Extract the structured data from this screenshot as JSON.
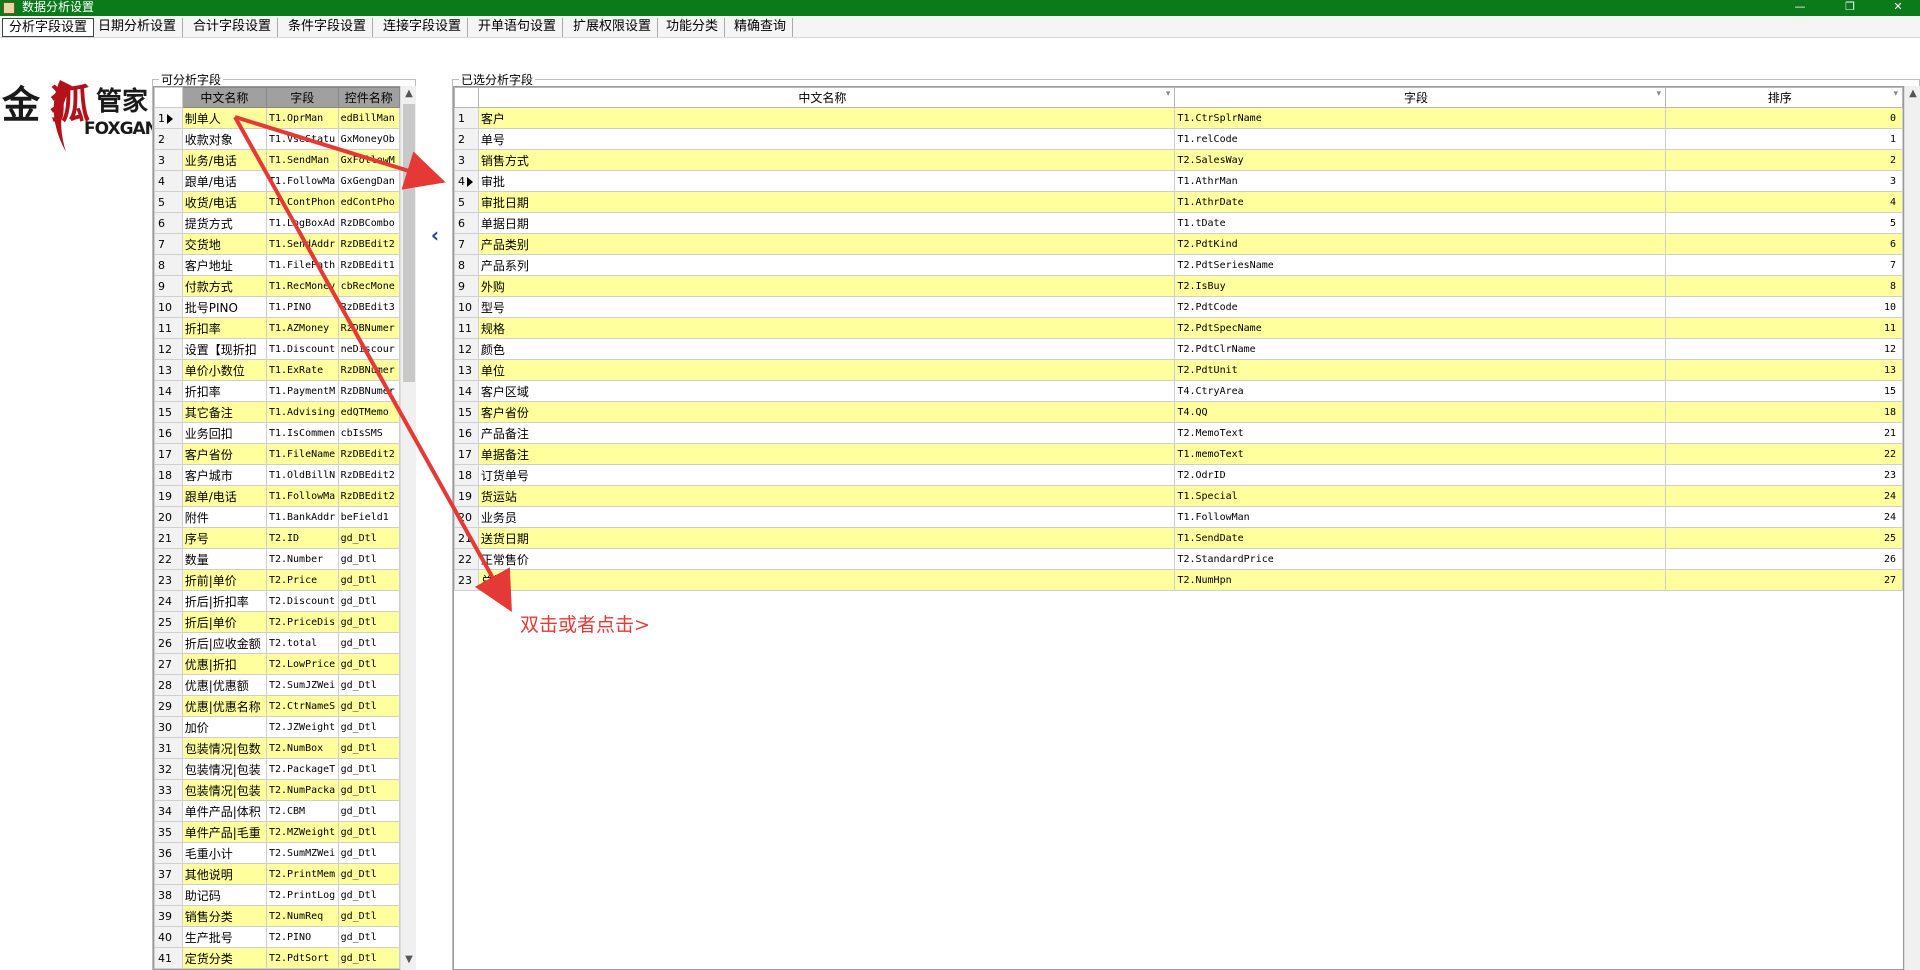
{
  "window": {
    "title": "数据分析设置"
  },
  "tabs": [
    {
      "label": "分析字段设置",
      "active": true
    },
    {
      "label": "日期分析设置",
      "active": false
    },
    {
      "label": "合计字段设置",
      "active": false
    },
    {
      "label": "条件字段设置",
      "active": false
    },
    {
      "label": "连接字段设置",
      "active": false
    },
    {
      "label": "开单语句设置",
      "active": false
    },
    {
      "label": "扩展权限设置",
      "active": false
    },
    {
      "label": "功能分类",
      "active": false
    },
    {
      "label": "精确查询",
      "active": false
    }
  ],
  "logo": {
    "cn": "金狐管家",
    "en": "FOXGAN"
  },
  "left_panel": {
    "label": "可分析字段",
    "columns": [
      "中文名称",
      "字段",
      "控件名称"
    ],
    "rows": [
      {
        "n": "1",
        "name": "制单人",
        "field": "T1.OprMan",
        "ctrl": "edBillMan",
        "y": true
      },
      {
        "n": "2",
        "name": "收款对象",
        "field": "T1.VseStatu",
        "ctrl": "GxMoneyOb",
        "y": false
      },
      {
        "n": "3",
        "name": "业务/电话",
        "field": "T1.SendMan",
        "ctrl": "GxFollowM",
        "y": true
      },
      {
        "n": "4",
        "name": "跟单/电话",
        "field": "T1.FollowMa",
        "ctrl": "GxGengDan",
        "y": false
      },
      {
        "n": "5",
        "name": "收货/电话",
        "field": "T1.ContPhon",
        "ctrl": "edContPho",
        "y": true
      },
      {
        "n": "6",
        "name": "提货方式",
        "field": "T1.LogBoxAd",
        "ctrl": "RzDBCombo",
        "y": false
      },
      {
        "n": "7",
        "name": "交货地",
        "field": "T1.SendAddr",
        "ctrl": "RzDBEdit2",
        "y": true
      },
      {
        "n": "8",
        "name": "客户地址",
        "field": "T1.FilePath",
        "ctrl": "RzDBEdit1",
        "y": false
      },
      {
        "n": "9",
        "name": "付款方式",
        "field": "T1.RecMoney",
        "ctrl": "cbRecMone",
        "y": true
      },
      {
        "n": "10",
        "name": "批号PINO",
        "field": "T1.PINO",
        "ctrl": "RzDBEdit3",
        "y": false
      },
      {
        "n": "11",
        "name": "折扣率",
        "field": "T1.AZMoney",
        "ctrl": "RzDBNumer",
        "y": true
      },
      {
        "n": "12",
        "name": "设置【现折扣",
        "field": "T1.Discount",
        "ctrl": "neDiscour",
        "y": false
      },
      {
        "n": "13",
        "name": "单价小数位",
        "field": "T1.ExRate",
        "ctrl": "RzDBNumer",
        "y": true
      },
      {
        "n": "14",
        "name": "折扣率",
        "field": "T1.PaymentM",
        "ctrl": "RzDBNumer",
        "y": false
      },
      {
        "n": "15",
        "name": "其它备注",
        "field": "T1.Advising",
        "ctrl": "edQTMemo",
        "y": true
      },
      {
        "n": "16",
        "name": "业务回扣",
        "field": "T1.IsCommen",
        "ctrl": "cbIsSMS",
        "y": false
      },
      {
        "n": "17",
        "name": "客户省份",
        "field": "T1.FileName",
        "ctrl": "RzDBEdit2",
        "y": true
      },
      {
        "n": "18",
        "name": "客户城市",
        "field": "T1.OldBillN",
        "ctrl": "RzDBEdit2",
        "y": false
      },
      {
        "n": "19",
        "name": "跟单/电话",
        "field": "T1.FollowMa",
        "ctrl": "RzDBEdit2",
        "y": true
      },
      {
        "n": "20",
        "name": "附件",
        "field": "T1.BankAddr",
        "ctrl": "beField1",
        "y": false
      },
      {
        "n": "21",
        "name": "序号",
        "field": "T2.ID",
        "ctrl": "gd_Dtl",
        "y": true
      },
      {
        "n": "22",
        "name": "数量",
        "field": "T2.Number",
        "ctrl": "gd_Dtl",
        "y": false
      },
      {
        "n": "23",
        "name": "折前|单价",
        "field": "T2.Price",
        "ctrl": "gd_Dtl",
        "y": true
      },
      {
        "n": "24",
        "name": "折后|折扣率",
        "field": "T2.Discount",
        "ctrl": "gd_Dtl",
        "y": false
      },
      {
        "n": "25",
        "name": "折后|单价",
        "field": "T2.PriceDis",
        "ctrl": "gd_Dtl",
        "y": true
      },
      {
        "n": "26",
        "name": "折后|应收金额",
        "field": "T2.total",
        "ctrl": "gd_Dtl",
        "y": false
      },
      {
        "n": "27",
        "name": "优惠|折扣",
        "field": "T2.LowPrice",
        "ctrl": "gd_Dtl",
        "y": true
      },
      {
        "n": "28",
        "name": "优惠|优惠额",
        "field": "T2.SumJZWei",
        "ctrl": "gd_Dtl",
        "y": false
      },
      {
        "n": "29",
        "name": "优惠|优惠名称",
        "field": "T2.CtrNameS",
        "ctrl": "gd_Dtl",
        "y": true
      },
      {
        "n": "30",
        "name": "加价",
        "field": "T2.JZWeight",
        "ctrl": "gd_Dtl",
        "y": false
      },
      {
        "n": "31",
        "name": "包装情况|包数",
        "field": "T2.NumBox",
        "ctrl": "gd_Dtl",
        "y": true
      },
      {
        "n": "32",
        "name": "包装情况|包装",
        "field": "T2.PackageT",
        "ctrl": "gd_Dtl",
        "y": false
      },
      {
        "n": "33",
        "name": "包装情况|包装",
        "field": "T2.NumPacka",
        "ctrl": "gd_Dtl",
        "y": true
      },
      {
        "n": "34",
        "name": "单件产品|体积",
        "field": "T2.CBM",
        "ctrl": "gd_Dtl",
        "y": false
      },
      {
        "n": "35",
        "name": "单件产品|毛重",
        "field": "T2.MZWeight",
        "ctrl": "gd_Dtl",
        "y": true
      },
      {
        "n": "36",
        "name": "毛重小计",
        "field": "T2.SumMZWei",
        "ctrl": "gd_Dtl",
        "y": false
      },
      {
        "n": "37",
        "name": "其他说明",
        "field": "T2.PrintMem",
        "ctrl": "gd_Dtl",
        "y": true
      },
      {
        "n": "38",
        "name": "助记码",
        "field": "T2.PrintLog",
        "ctrl": "gd_Dtl",
        "y": false
      },
      {
        "n": "39",
        "name": "销售分类",
        "field": "T2.NumReq",
        "ctrl": "gd_Dtl",
        "y": true
      },
      {
        "n": "40",
        "name": "生产批号",
        "field": "T2.PINO",
        "ctrl": "gd_Dtl",
        "y": false
      },
      {
        "n": "41",
        "name": "定货分类",
        "field": "T2.PdtSort",
        "ctrl": "gd_Dtl",
        "y": true
      }
    ]
  },
  "right_panel": {
    "label": "已选分析字段",
    "columns": [
      "中文名称",
      "字段",
      "排序"
    ],
    "rows": [
      {
        "n": "1",
        "name": "客户",
        "field": "T1.CtrSplrName",
        "order": "0",
        "y": true
      },
      {
        "n": "2",
        "name": "单号",
        "field": "T1.relCode",
        "order": "1",
        "y": false
      },
      {
        "n": "3",
        "name": "销售方式",
        "field": "T2.SalesWay",
        "order": "2",
        "y": true
      },
      {
        "n": "4",
        "name": "审批",
        "field": "T1.AthrMan",
        "order": "3",
        "y": false
      },
      {
        "n": "5",
        "name": "审批日期",
        "field": "T1.AthrDate",
        "order": "4",
        "y": true
      },
      {
        "n": "6",
        "name": "单据日期",
        "field": "T1.tDate",
        "order": "5",
        "y": false
      },
      {
        "n": "7",
        "name": "产品类别",
        "field": "T2.PdtKind",
        "order": "6",
        "y": true
      },
      {
        "n": "8",
        "name": "产品系列",
        "field": "T2.PdtSeriesName",
        "order": "7",
        "y": false
      },
      {
        "n": "9",
        "name": "外购",
        "field": "T2.IsBuy",
        "order": "8",
        "y": true
      },
      {
        "n": "10",
        "name": "型号",
        "field": "T2.PdtCode",
        "order": "10",
        "y": false
      },
      {
        "n": "11",
        "name": "规格",
        "field": "T2.PdtSpecName",
        "order": "11",
        "y": true
      },
      {
        "n": "12",
        "name": "颜色",
        "field": "T2.PdtClrName",
        "order": "12",
        "y": false
      },
      {
        "n": "13",
        "name": "单位",
        "field": "T2.PdtUnit",
        "order": "13",
        "y": true
      },
      {
        "n": "14",
        "name": "客户区域",
        "field": "T4.CtryArea",
        "order": "15",
        "y": false
      },
      {
        "n": "15",
        "name": "客户省份",
        "field": "T4.QQ",
        "order": "18",
        "y": true
      },
      {
        "n": "16",
        "name": "产品备注",
        "field": "T2.MemoText",
        "order": "21",
        "y": false
      },
      {
        "n": "17",
        "name": "单据备注",
        "field": "T1.memoText",
        "order": "22",
        "y": true
      },
      {
        "n": "18",
        "name": "订货单号",
        "field": "T2.OdrID",
        "order": "23",
        "y": false
      },
      {
        "n": "19",
        "name": "货运站",
        "field": "T1.Special",
        "order": "24",
        "y": true
      },
      {
        "n": "20",
        "name": "业务员",
        "field": "T1.FollowMan",
        "order": "24",
        "y": false
      },
      {
        "n": "21",
        "name": "送货日期",
        "field": "T1.SendDate",
        "order": "25",
        "y": true
      },
      {
        "n": "22",
        "name": "正常售价",
        "field": "T2.StandardPrice",
        "order": "26",
        "y": false
      },
      {
        "n": "23",
        "name": "总量",
        "field": "T2.NumHpn",
        "order": "27",
        "y": true
      }
    ]
  },
  "buttons": {
    "move_right": "›",
    "move_left": "‹"
  },
  "annotation": {
    "hint": "双击或者点击>",
    "color": "#e53935"
  }
}
